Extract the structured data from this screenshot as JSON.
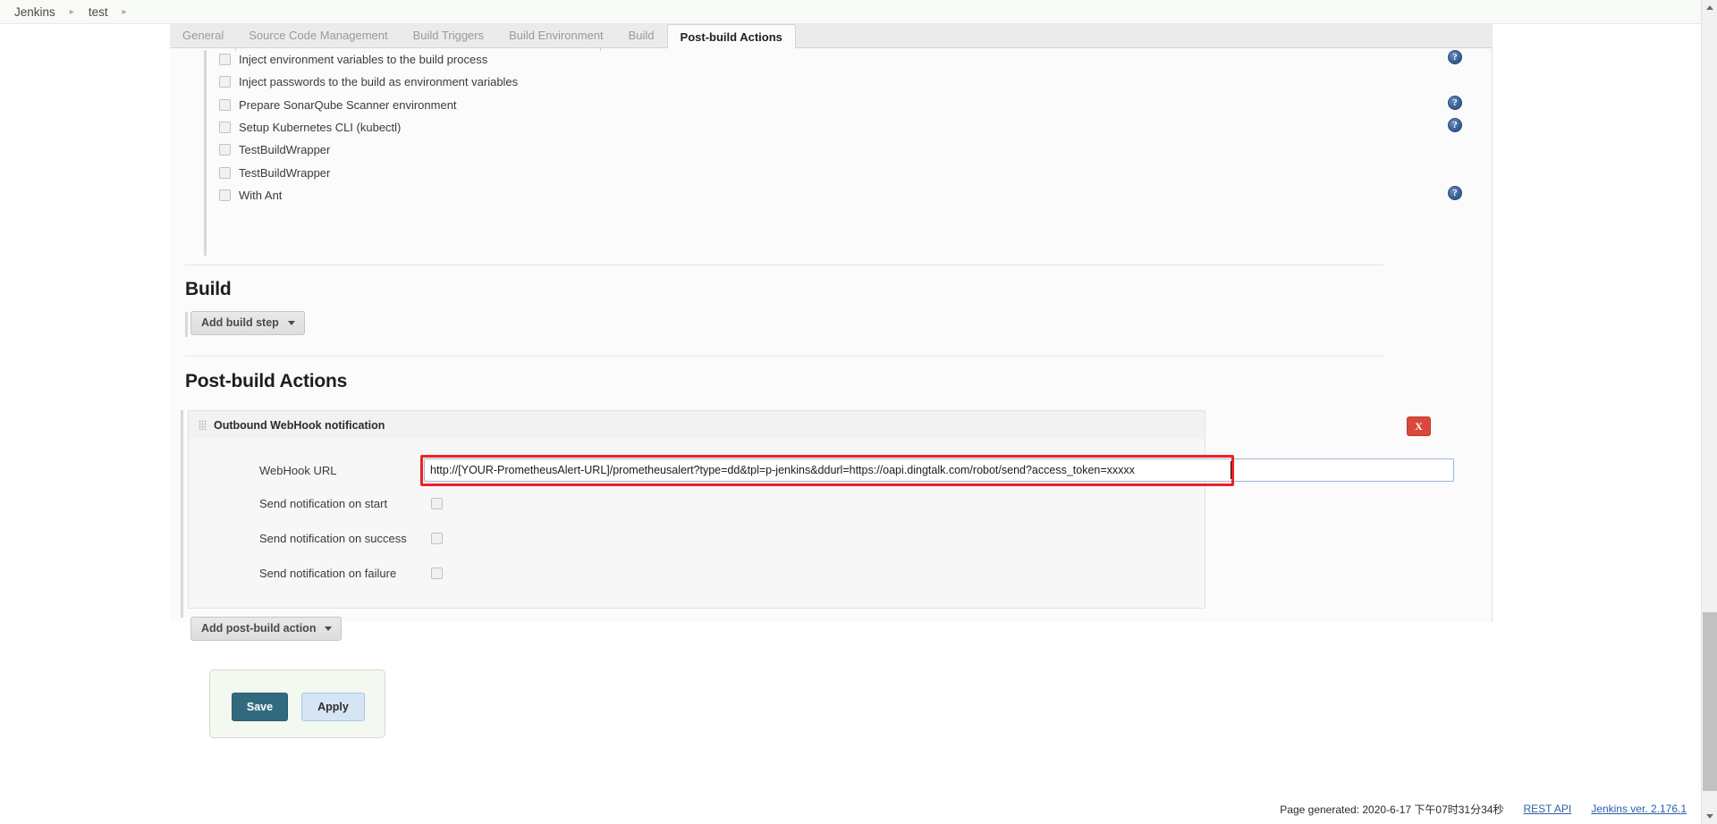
{
  "breadcrumb": {
    "items": [
      {
        "label": "Jenkins"
      },
      {
        "label": "test"
      }
    ],
    "separator": "▸"
  },
  "tabs": [
    {
      "label": "General",
      "active": false
    },
    {
      "label": "Source Code Management",
      "active": false
    },
    {
      "label": "Build Triggers",
      "active": false
    },
    {
      "label": "Build Environment",
      "active": false
    },
    {
      "label": "Build",
      "active": false
    },
    {
      "label": "Post-build Actions",
      "active": true
    }
  ],
  "build_environment": {
    "wrappers": [
      {
        "label": "Inject environment variables to the build process",
        "checked": false,
        "help": true
      },
      {
        "label": "Inject passwords to the build as environment variables",
        "checked": false,
        "help": false
      },
      {
        "label": "Prepare SonarQube Scanner environment",
        "checked": false,
        "help": true
      },
      {
        "label": "Setup Kubernetes CLI (kubectl)",
        "checked": false,
        "help": true
      },
      {
        "label": "TestBuildWrapper",
        "checked": false,
        "help": false
      },
      {
        "label": "TestBuildWrapper",
        "checked": false,
        "help": false
      },
      {
        "label": "With Ant",
        "checked": false,
        "help": true
      }
    ]
  },
  "build_section": {
    "title": "Build",
    "add_build_step_label": "Add build step"
  },
  "postbuild_section": {
    "title": "Post-build Actions",
    "add_postbuild_label": "Add post-build action",
    "action": {
      "title": "Outbound WebHook notification",
      "remove_label": "X",
      "url_field": {
        "label": "WebHook URL",
        "value": "http://[YOUR-PrometheusAlert-URL]/prometheusalert?type=dd&tpl=p-jenkins&ddurl=https://oapi.dingtalk.com/robot/send?access_token=xxxxx",
        "placeholder": ""
      },
      "checkboxes": [
        {
          "label": "Send notification on start",
          "checked": false
        },
        {
          "label": "Send notification on success",
          "checked": false
        },
        {
          "label": "Send notification on failure",
          "checked": false
        }
      ]
    }
  },
  "form_buttons": {
    "save_label": "Save",
    "apply_label": "Apply"
  },
  "footer": {
    "page_generated": "Page generated: 2020-6-17 下午07时31分34秒",
    "rest_api_label": "REST API",
    "version_label": "Jenkins ver. 2.176.1"
  },
  "colors": {
    "accent_blue": "#2b5fa8",
    "save_teal": "#316a7f",
    "apply_blue": "#d5e5f5",
    "remove_red": "#d9483b",
    "highlight_red": "#ee2222"
  }
}
